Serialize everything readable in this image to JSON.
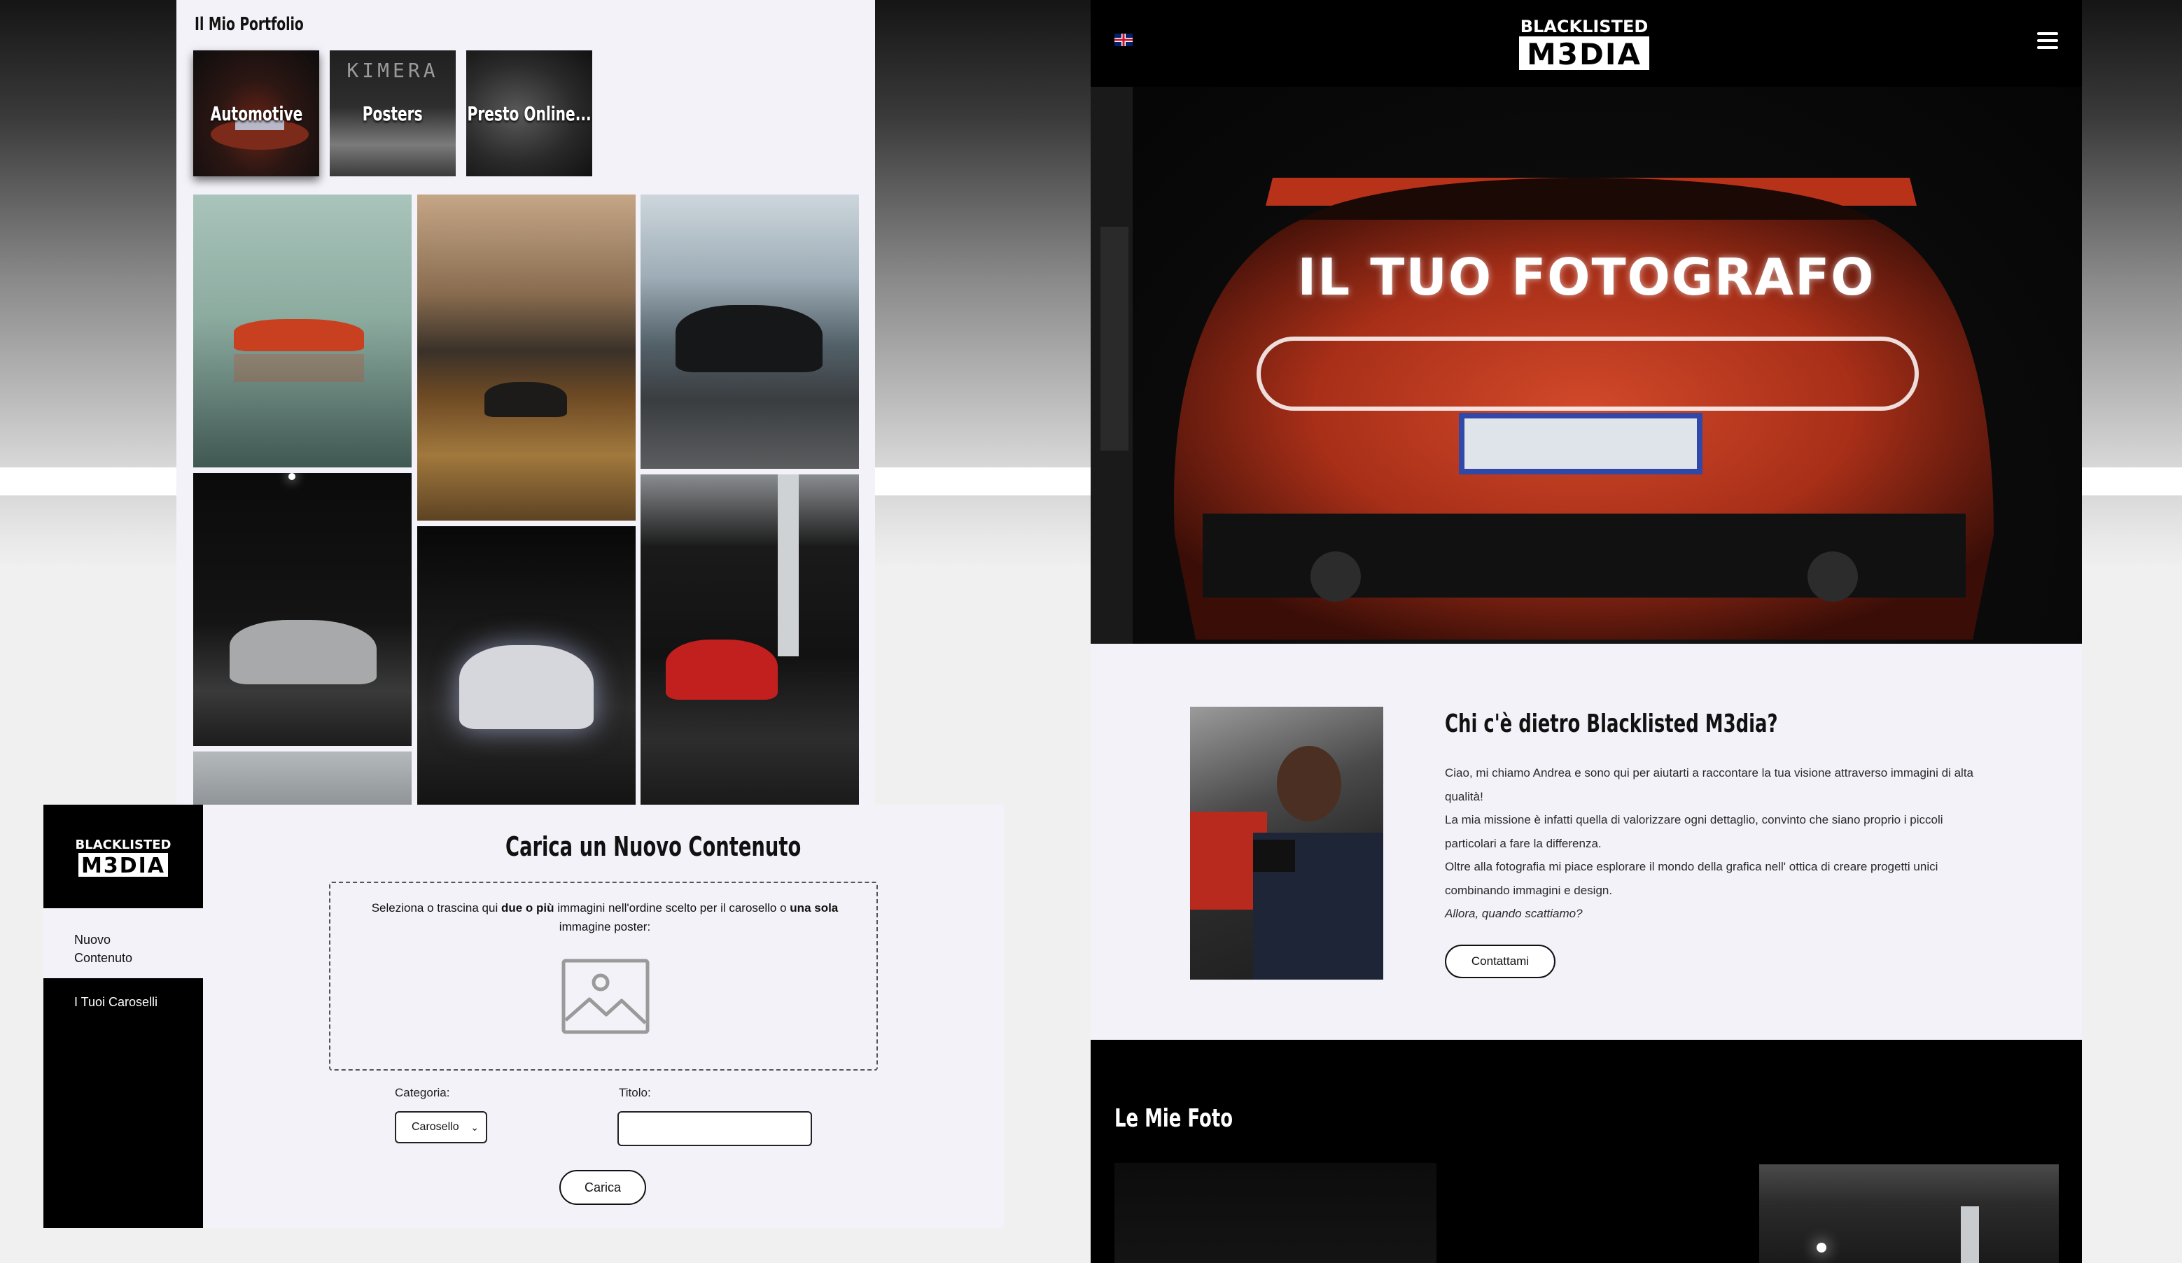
{
  "portfolio": {
    "title": "Il Mio Portfolio",
    "categories": [
      {
        "label": "Automotive",
        "active": true
      },
      {
        "label": "Posters",
        "active": false
      },
      {
        "label": "Presto Online...",
        "active": false
      }
    ],
    "posters_thumb_text": "KIMERA"
  },
  "upload": {
    "sidebar": {
      "logo_line1": "BLACKLISTED",
      "logo_line2": "M3DIA",
      "items": [
        {
          "label_line1": "Nuovo",
          "label_line2": "Contenuto",
          "active": true
        },
        {
          "label": "I Tuoi Caroselli",
          "active": false
        }
      ]
    },
    "heading": "Carica un Nuovo Contenuto",
    "dropzone": {
      "text_1": "Seleziona o trascina qui ",
      "text_bold_1": "due o più",
      "text_2": " immagini nell'ordine scelto per il carosello o ",
      "text_bold_2": "una sola",
      "text_3": " immagine poster:"
    },
    "category_label": "Categoria:",
    "category_selected": "Carosello",
    "title_label": "Titolo:",
    "title_value": "",
    "submit_label": "Carica"
  },
  "home": {
    "logo_line1": "BLACKLISTED",
    "logo_line2": "M3DIA",
    "hero_title": "IL TUO FOTOGRAFO",
    "about": {
      "title": "Chi c'è dietro Blacklisted M3dia?",
      "line_1": "Ciao, mi chiamo Andrea e sono qui per aiutarti a raccontare la tua visione attraverso immagini di alta qualità!",
      "line_2": "La mia missione è infatti quella di valorizzare ogni dettaglio, convinto che siano proprio i piccoli particolari a fare la differenza.",
      "line_3": "Oltre alla fotografia mi piace esplorare il mondo della grafica nell' ottica di creare progetti unici combinando immagini e design.",
      "line_4": "Allora, quando scattiamo?",
      "button": "Contattami"
    },
    "photos_title": "Le Mie Foto"
  },
  "colors": {
    "page_bg": "#f3f2f8",
    "black": "#000000",
    "supra_red": "#b8321a"
  }
}
